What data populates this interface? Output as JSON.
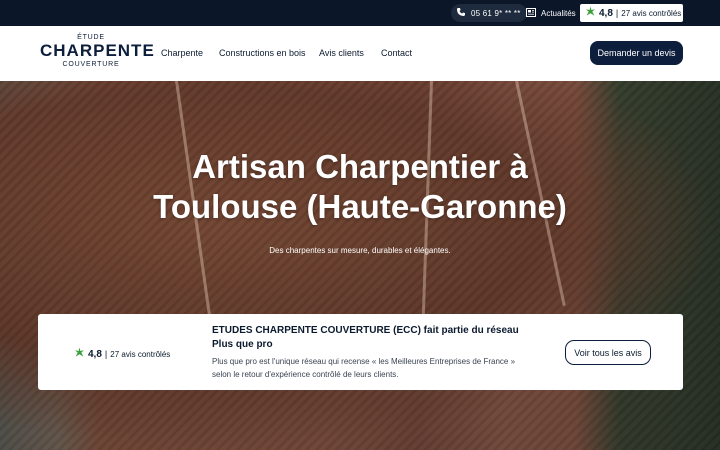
{
  "topbar": {
    "phone": "05 61 9* ** **",
    "news_label": "Actualités",
    "rating": {
      "score": "4,8",
      "separator": "|",
      "count": "27 avis contrôlés"
    }
  },
  "header": {
    "logo": {
      "line1": "ÉTUDE",
      "line2": "CHARPENTE",
      "line3": "COUVERTURE"
    },
    "nav": [
      "Charpente",
      "Constructions en bois",
      "Avis clients",
      "Contact"
    ],
    "cta_label": "Demander un devis"
  },
  "hero": {
    "title_line1": "Artisan Charpentier à",
    "title_line2": "Toulouse (Haute-Garonne)",
    "subtitle": "Des charpentes sur mesure, durables et élégantes."
  },
  "review_card": {
    "rating": {
      "score": "4,8",
      "separator": "|",
      "count": "27 avis contrôlés"
    },
    "title": "ETUDES CHARPENTE COUVERTURE (ECC) fait partie du réseau Plus que pro",
    "text": "Plus que pro est l'unique réseau qui recense « les Meilleures Entreprises de France » selon le retour d'expérience contrôlé de leurs clients.",
    "button_label": "Voir tous les avis"
  },
  "colors": {
    "navy": "#0c1e3b",
    "topbar_bg": "#0b1629",
    "accent_green": "#3aa03a"
  },
  "icons": [
    "phone-icon",
    "newspaper-icon",
    "plus-que-pro-star-icon"
  ]
}
